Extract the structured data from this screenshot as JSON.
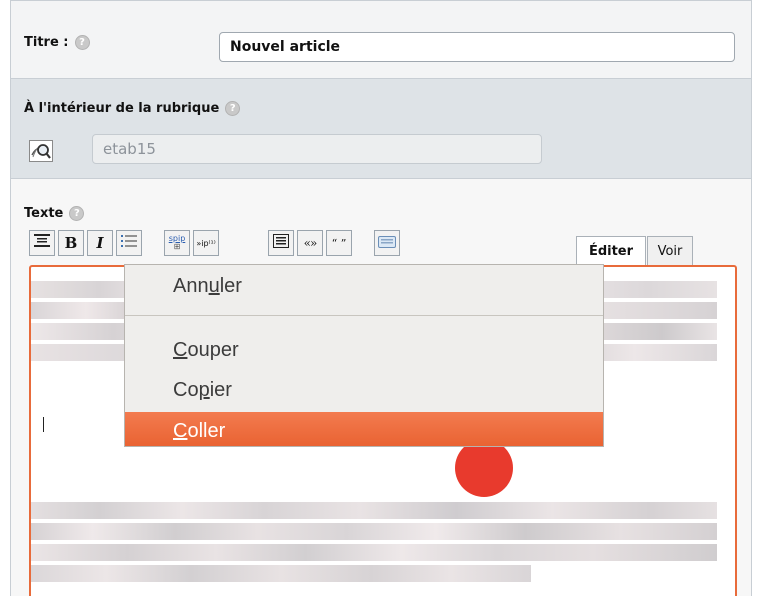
{
  "titre": {
    "label": "Titre :",
    "help_symbol": "?",
    "value": "Nouvel article"
  },
  "rubrique": {
    "label": "À l'intérieur de la rubrique",
    "help_symbol": "?",
    "icon": "rubrique-browse-icon",
    "value": "etab15"
  },
  "texte": {
    "label": "Texte",
    "help_symbol": "?"
  },
  "toolbar": {
    "bold": "B",
    "italic": "I",
    "list_icon": "bullet-list-icon",
    "heading_icon": "intertitle-icon",
    "spip_link_text": "spip",
    "footnote_text": "»ip⁽¹⁾",
    "paragraph_icon": "paragraph-icon",
    "quote_fr": "«»",
    "quote_en": "“ ”",
    "keyboard_icon": "keyboard-icon"
  },
  "tabs": {
    "edit": "Éditer",
    "preview": "Voir"
  },
  "context_menu": {
    "undo_pre": "Ann",
    "undo_u": "u",
    "undo_post": "ler",
    "cut_u": "C",
    "cut_post": "ouper",
    "copy_pre": "Co",
    "copy_u": "p",
    "copy_post": "ier",
    "paste_u": "C",
    "paste_post": "oller",
    "highlighted": "Coller"
  },
  "colors": {
    "accent": "#e86b3b",
    "menu_highlight": "#ef6f3f",
    "section_bg": "#dee3e7"
  }
}
